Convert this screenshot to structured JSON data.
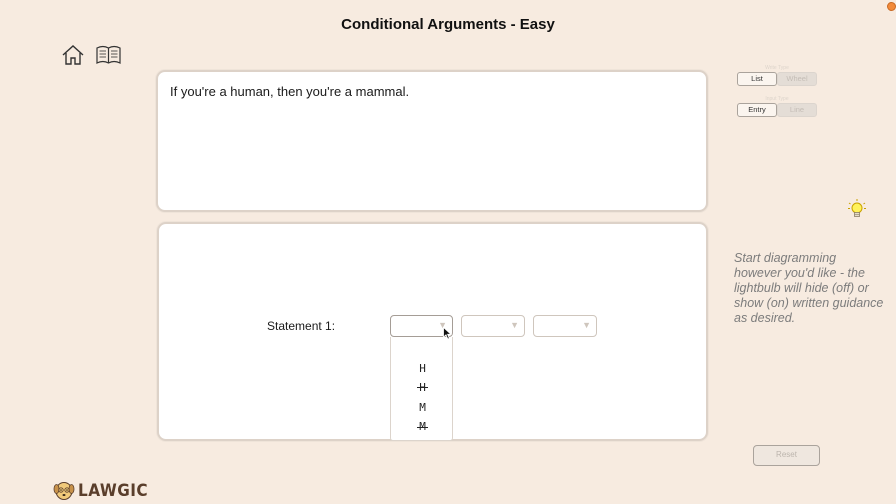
{
  "header": {
    "title": "Conditional Arguments - Easy"
  },
  "nav": {
    "home_icon": "home-icon",
    "book_icon": "book-icon"
  },
  "problem": {
    "text": "If you're a human, then you're a mammal."
  },
  "statement": {
    "label": "Statement 1:",
    "dropdown_options": [
      "H",
      "H",
      "M",
      "M"
    ],
    "dropdown_negated": [
      false,
      true,
      false,
      true
    ]
  },
  "controls": {
    "view_caption": "Write Type",
    "view_options": [
      "List",
      "Wheel"
    ],
    "entry_caption": "Input Type",
    "entry_options": [
      "Entry",
      "Line"
    ],
    "reset_label": "Reset"
  },
  "guidance": {
    "text": "Start diagramming however you'd like - the lightbulb will hide (off) or show (on) written guidance as desired."
  },
  "brand": {
    "logo_text": "LAWGIC",
    "accent": "#5a3e2b"
  }
}
